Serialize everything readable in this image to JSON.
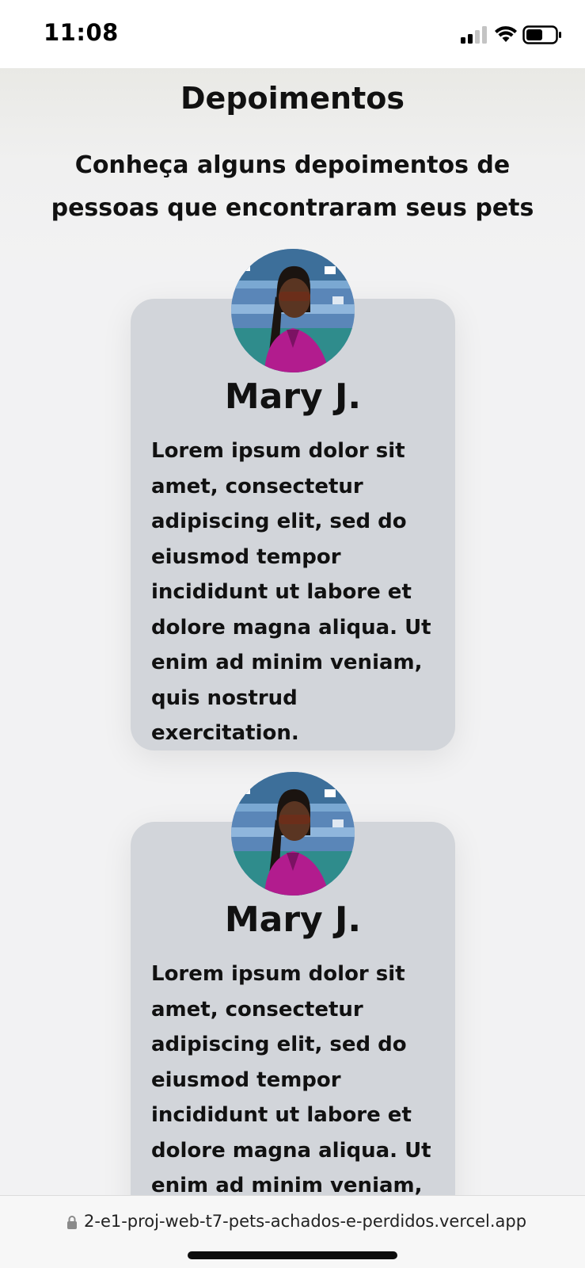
{
  "status_bar": {
    "time": "11:08"
  },
  "page": {
    "title": "Depoimentos",
    "subtitle": "Conheça alguns depoimentos de pessoas que encontraram seus pets"
  },
  "testimonials": [
    {
      "name": "Mary J.",
      "text": "Lorem ipsum dolor sit amet, consectetur adipiscing elit, sed do eiusmod tempor incididunt ut labore et dolore magna aliqua. Ut enim ad minim veniam, quis nostrud exercitation."
    },
    {
      "name": "Mary J.",
      "text": "Lorem ipsum dolor sit amet, consectetur adipiscing elit, sed do eiusmod tempor incididunt ut labore et dolore magna aliqua. Ut enim ad minim veniam, quis nostrud exercitation."
    }
  ],
  "browser": {
    "url": "2-e1-proj-web-t7-pets-achados-e-perdidos.vercel.app"
  },
  "icons": {
    "signal": "cellular-signal-icon",
    "wifi": "wifi-icon",
    "battery": "battery-icon",
    "lock": "lock-icon",
    "avatar": "avatar-photo"
  },
  "colors": {
    "card_background": "#d2d5da",
    "page_background": "#f2f2f3",
    "text": "#111111"
  }
}
